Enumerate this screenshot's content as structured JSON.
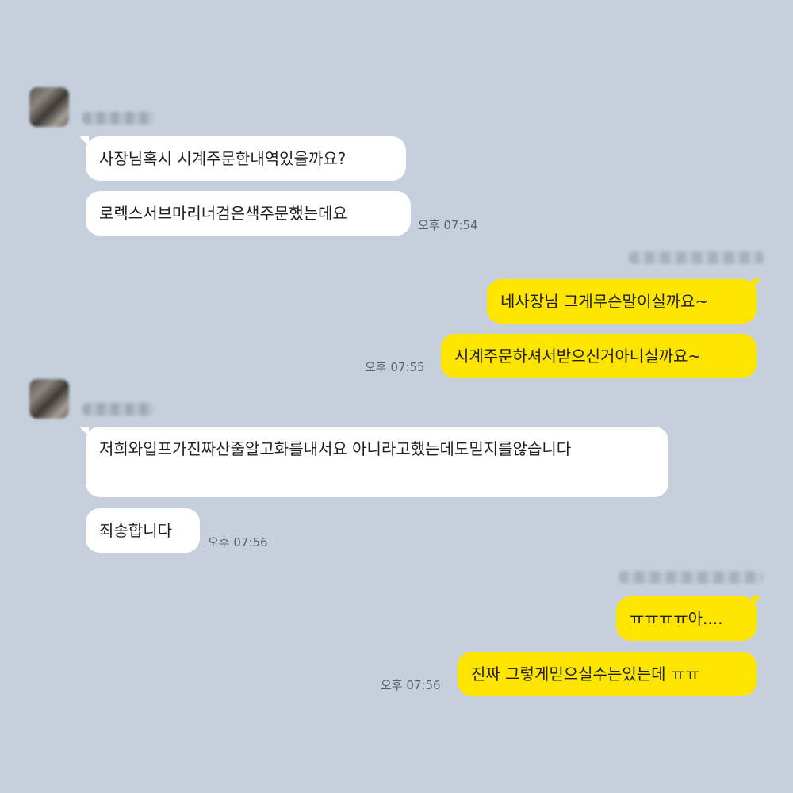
{
  "colors": {
    "background": "#c6d0dd",
    "incoming_bubble": "#ffffff",
    "outgoing_bubble": "#fee500",
    "timestamp": "#556170"
  },
  "groups": [
    {
      "side": "incoming",
      "sender": "",
      "messages": [
        "사장님혹시 시계주문한내역있을까요?",
        "로렉스서브마리너검은색주문했는데요"
      ],
      "time": "오후 07:54"
    },
    {
      "side": "outgoing",
      "sender": "",
      "messages": [
        "네사장님 그게무슨말이실까요~",
        "시계주문하셔서받으신거아니실까요~"
      ],
      "time": "오후 07:55"
    },
    {
      "side": "incoming",
      "sender": "",
      "messages": [
        "저희와입프가진짜산줄알고화를내서요 아니라고했는데도믿지를않습니다",
        "죄송합니다"
      ],
      "time": "오후 07:56"
    },
    {
      "side": "outgoing",
      "sender": "",
      "messages": [
        "ㅠㅠㅠㅠ아....",
        "진짜 그렇게믿으실수는있는데 ㅠㅠ"
      ],
      "time": "오후 07:56"
    }
  ]
}
